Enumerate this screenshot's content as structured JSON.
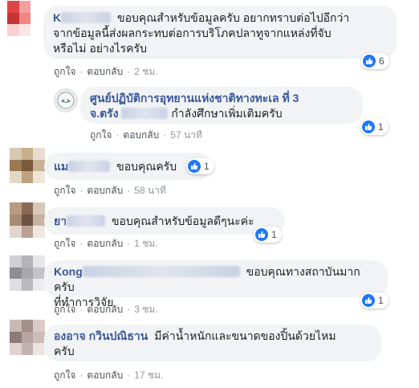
{
  "comments": [
    {
      "name_visible": "K",
      "text_line1": "ขอบคุณสำหรับข้อมูลครับ อยากทราบต่อไปอีกว่า",
      "text_line2": "จากข้อมูลนี้ส่งผลกระทบต่อการบริโภคปลาทูจากแหล่งที่จับ",
      "text_line3": "หรือไม่ อย่างไรครับ",
      "reactions": "6",
      "like": "ถูกใจ",
      "reply": "ตอบกลับ",
      "time": "2 ชม.",
      "avatar_colors": [
        "#e04444",
        "#f4a0a0",
        "#ffffff",
        "#c53535",
        "#f08585",
        "#ffffff",
        "#f9d0d0",
        "#fbe5e5",
        "#ffffff"
      ]
    },
    {
      "name_line1": "ศูนย์ปฏิบัติการอุทยานแห่งชาติทางทะเล ที่ 3",
      "name_line2": "จ.ตรัง",
      "text": "กำลังศึกษาเพิ่มเติมครับ",
      "reactions": "1",
      "like": "ถูกใจ",
      "reply": "ตอบกลับ",
      "time": "57 นาที"
    },
    {
      "name_visible": "แม",
      "text": "ขอบคุณครับ",
      "reactions": "1",
      "like": "ถูกใจ",
      "reply": "ตอบกลับ",
      "time": "58 นาที",
      "avatar_colors": [
        "#d8c8b0",
        "#c8b08c",
        "#e8ddd0",
        "#9b7a55",
        "#7a5a38",
        "#c9b393",
        "#e3d7c5",
        "#bfa27e",
        "#efe6da"
      ]
    },
    {
      "name_visible": "ยา",
      "text": "ขอบคุณสำหรับข้อมูลดีๆนะค่ะ",
      "reactions": "1",
      "like": "ถูกใจ",
      "reply": "ตอบกลับ",
      "time": "1 ชม.",
      "avatar_colors": [
        "#b89a80",
        "#8a6a55",
        "#d8c8bb",
        "#a68a74",
        "#6e5040",
        "#c6b3a4",
        "#e2d6cc",
        "#b7a292",
        "#efe8e2"
      ]
    },
    {
      "name_visible": "Kong",
      "text_line1": "ขอบคุณทางสถาบันมากครับ",
      "text_line2": "ที่ทำการวิจัย",
      "reactions": "1",
      "like": "ถูกใจ",
      "reply": "ตอบกลับ",
      "time": "3 ชม.",
      "avatar_colors": [
        "#d0cfd3",
        "#b4b3b8",
        "#e6e5e8",
        "#8f8e94",
        "#a9a8ad",
        "#c4c3c8",
        "#dedde1",
        "#bab9be",
        "#ecebee"
      ]
    },
    {
      "name": "องอาจ กวินปณิธาน",
      "text_line1": "มีค่าน้ำหนักและขนาดของปิ้นด้วยไหม",
      "text_line2": "ครับ",
      "like": "ถูกใจ",
      "reply": "ตอบกลับ",
      "time": "17 ชม.",
      "avatar_colors": [
        "#c9b9b4",
        "#a48f8a",
        "#d9ccc8",
        "#8e7a76",
        "#b8a5a1",
        "#cbbdb9",
        "#ded3d0",
        "#c3b3af",
        "#ebe4e2"
      ]
    }
  ]
}
